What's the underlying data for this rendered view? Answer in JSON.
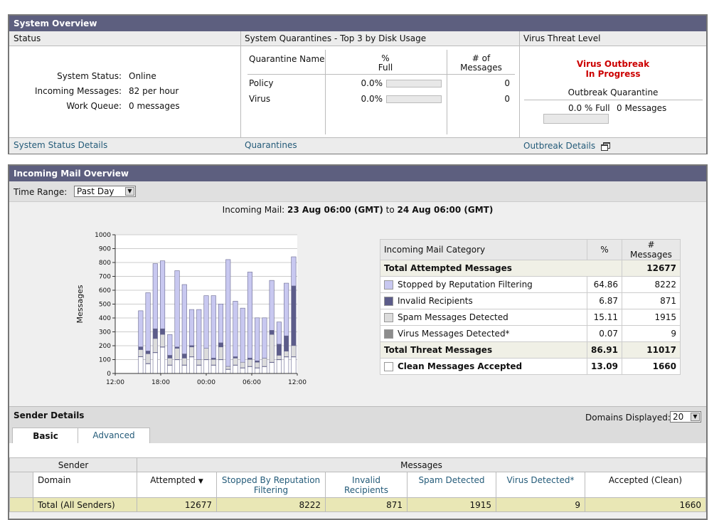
{
  "system_overview": {
    "title": "System Overview",
    "status": {
      "heading": "Status",
      "rows": [
        {
          "label": "System Status:",
          "value": "Online"
        },
        {
          "label": "Incoming Messages:",
          "value": "82 per hour"
        },
        {
          "label": "Work Queue:",
          "value": "0 messages"
        }
      ],
      "footer_link": "System Status Details"
    },
    "quarantines": {
      "heading": "System Quarantines - Top 3 by Disk Usage",
      "col_name": "Quarantine Name",
      "col_pct": "%\nFull",
      "col_count": "# of\nMessages",
      "rows": [
        {
          "name": "Policy",
          "pct": "0.0%",
          "fill": 0,
          "count": "0"
        },
        {
          "name": "Virus",
          "pct": "0.0%",
          "fill": 0,
          "count": "0"
        }
      ],
      "footer_link": "Quarantines"
    },
    "virus": {
      "heading": "Virus Threat Level",
      "alert_line1": "Virus Outbreak",
      "alert_line2": "In Progress",
      "outbreak_label": "Outbreak Quarantine",
      "full_text": "0.0 % Full",
      "messages_text": "0 Messages",
      "fill": 0,
      "footer_link": "Outbreak Details",
      "popout_icon": "popout-window-icon",
      "alert_color": "#cc0000"
    }
  },
  "incoming": {
    "title": "Incoming Mail Overview",
    "time_range_label": "Time Range:",
    "time_range_value": "Past Day",
    "range_prefix": "Incoming Mail:",
    "range_from": "23 Aug 06:00 (GMT)",
    "range_to_word": "to",
    "range_to": "24 Aug 06:00 (GMT)",
    "category_table": {
      "headers": [
        "Incoming Mail Category",
        "%",
        "# Messages"
      ],
      "total_attempted": {
        "label": "Total Attempted Messages",
        "pct": "",
        "count": "12677"
      },
      "rows": [
        {
          "label": "Stopped by Reputation Filtering",
          "pct": "64.86",
          "count": "8222",
          "color": "#c8c8f0"
        },
        {
          "label": "Invalid Recipients",
          "pct": "6.87",
          "count": "871",
          "color": "#5c5c8a"
        },
        {
          "label": "Spam Messages Detected",
          "pct": "15.11",
          "count": "1915",
          "color": "#dcdcdc"
        },
        {
          "label": "Virus Messages Detected*",
          "pct": "0.07",
          "count": "9",
          "color": "#8c8c8c"
        }
      ],
      "total_threat": {
        "label": "Total Threat Messages",
        "pct": "86.91",
        "count": "11017"
      },
      "clean": {
        "label": "Clean Messages Accepted",
        "pct": "13.09",
        "count": "1660",
        "color": "#ffffff"
      }
    }
  },
  "chart_data": {
    "type": "bar",
    "stacked": true,
    "ylabel": "Messages",
    "xlabel": "",
    "ylim": [
      0,
      1000
    ],
    "yticks": [
      0,
      100,
      200,
      300,
      400,
      500,
      600,
      700,
      800,
      900,
      1000
    ],
    "xticks": [
      "12:00",
      "18:00",
      "00:00",
      "06:00",
      "12:00"
    ],
    "bar_count": 25,
    "series": [
      {
        "name": "Clean Messages Accepted",
        "color": "#ffffff",
        "values": [
          0,
          0,
          0,
          120,
          70,
          150,
          190,
          60,
          100,
          60,
          120,
          60,
          100,
          60,
          100,
          30,
          60,
          40,
          50,
          40,
          50,
          80,
          100,
          120,
          120
        ]
      },
      {
        "name": "Virus Messages Detected*",
        "color": "#8c8c8c",
        "values": [
          0,
          0,
          0,
          2,
          2,
          2,
          2,
          1,
          1,
          1,
          1,
          1,
          1,
          1,
          1,
          1,
          1,
          1,
          1,
          1,
          1,
          1,
          1,
          1,
          1
        ]
      },
      {
        "name": "Spam Messages Detected",
        "color": "#dcdcdc",
        "values": [
          0,
          0,
          0,
          50,
          70,
          100,
          90,
          50,
          80,
          50,
          70,
          40,
          80,
          40,
          90,
          20,
          50,
          40,
          50,
          40,
          60,
          200,
          30,
          40,
          80
        ]
      },
      {
        "name": "Invalid Recipients",
        "color": "#5c5c8a",
        "values": [
          0,
          0,
          0,
          20,
          20,
          70,
          40,
          20,
          10,
          30,
          10,
          0,
          0,
          10,
          30,
          0,
          10,
          0,
          10,
          10,
          0,
          30,
          80,
          110,
          430
        ]
      },
      {
        "name": "Stopped by Reputation Filtering",
        "color": "#c8c8f0",
        "values": [
          0,
          0,
          0,
          260,
          420,
          470,
          490,
          150,
          550,
          500,
          260,
          360,
          380,
          450,
          280,
          770,
          400,
          390,
          620,
          310,
          290,
          360,
          160,
          380,
          210
        ]
      }
    ]
  },
  "sender_details": {
    "title": "Sender Details",
    "domains_label": "Domains Displayed:",
    "domains_value": "20",
    "tabs": [
      "Basic",
      "Advanced"
    ],
    "group_sender": "Sender",
    "group_messages": "Messages",
    "columns": [
      "Domain",
      "Attempted",
      "Stopped By Reputation Filtering",
      "Invalid Recipients",
      "Spam Detected",
      "Virus Detected*",
      "Accepted (Clean)"
    ],
    "sort_icon": "sort-desc-icon",
    "total_row": [
      "Total (All Senders)",
      "12677",
      "8222",
      "871",
      "1915",
      "9",
      "1660"
    ]
  }
}
